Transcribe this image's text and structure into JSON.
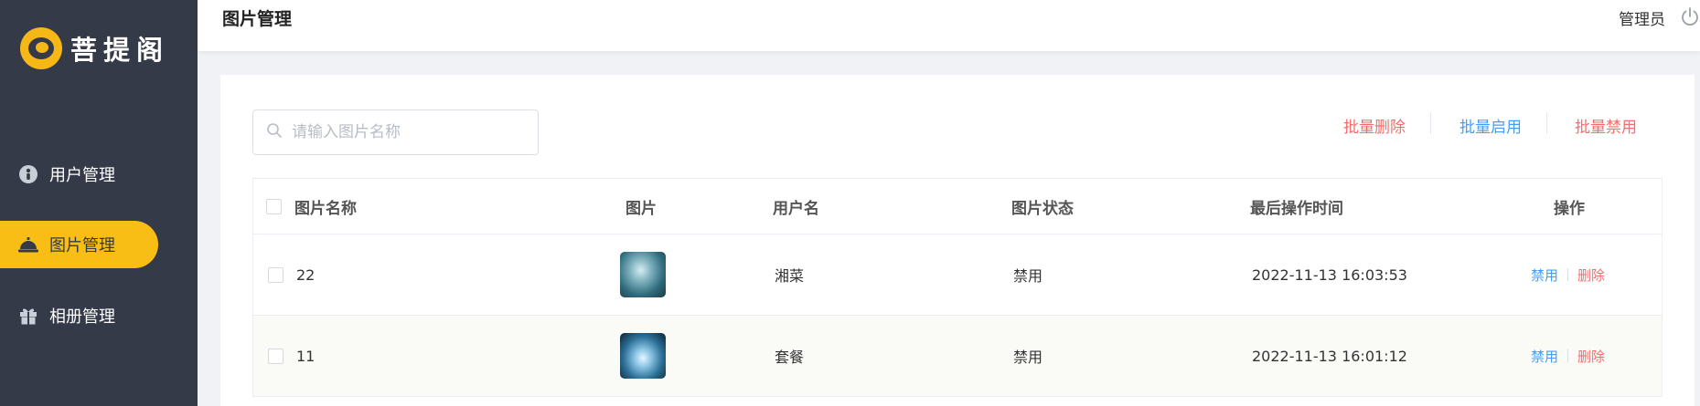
{
  "app": {
    "name": "菩提阁"
  },
  "sidebar": {
    "items": [
      {
        "label": "用户管理",
        "icon": "user-icon",
        "active": false
      },
      {
        "label": "图片管理",
        "icon": "cloche-icon",
        "active": true
      },
      {
        "label": "相册管理",
        "icon": "gift-icon",
        "active": false
      }
    ]
  },
  "header": {
    "title": "图片管理",
    "user": "管理员",
    "power_icon": "power-icon"
  },
  "search": {
    "placeholder": "请输入图片名称",
    "value": ""
  },
  "batch": {
    "delete": "批量删除",
    "enable": "批量启用",
    "disable": "批量禁用"
  },
  "table": {
    "headers": [
      "图片名称",
      "图片",
      "用户名",
      "图片状态",
      "最后操作时间",
      "操作"
    ],
    "rows": [
      {
        "name": "22",
        "image": "tornado-thumbnail",
        "user": "湘菜",
        "status": "禁用",
        "time": "2022-11-13 16:03:53",
        "op_toggle": "禁用",
        "op_delete": "删除"
      },
      {
        "name": "11",
        "image": "light-burst-thumbnail",
        "user": "套餐",
        "status": "禁用",
        "time": "2022-11-13 16:01:12",
        "op_toggle": "禁用",
        "op_delete": "删除"
      }
    ]
  },
  "colors": {
    "sidebar": "#343a48",
    "accent": "#f9be16",
    "link": "#409eff",
    "danger": "#f56c6c"
  }
}
